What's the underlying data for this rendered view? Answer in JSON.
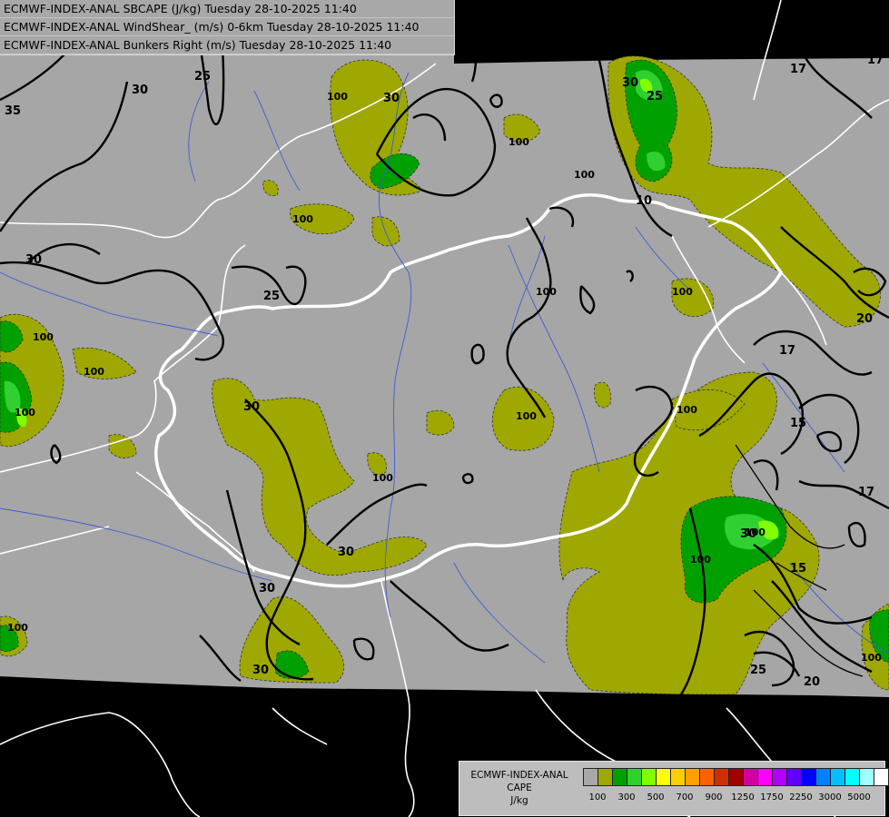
{
  "header": {
    "lines": [
      "ECMWF-INDEX-ANAL SBCAPE (J/kg) Tuesday 28-10-2025 11:40",
      "ECMWF-INDEX-ANAL WindShear_ (m/s) 0-6km Tuesday 28-10-2025 11:40",
      "ECMWF-INDEX-ANAL Bunkers Right (m/s) Tuesday 28-10-2025 11:40"
    ]
  },
  "legend": {
    "title_line1": "ECMWF-INDEX-ANAL",
    "title_line2": "CAPE",
    "unit": "J/kg",
    "colors": [
      "#a8a8a8",
      "#9ea800",
      "#00a000",
      "#30d030",
      "#80ff00",
      "#ffff00",
      "#ffd000",
      "#ffa000",
      "#ff6000",
      "#d03000",
      "#a00000",
      "#d000a0",
      "#ff00ff",
      "#b000ff",
      "#6000ff",
      "#0000ff",
      "#0080ff",
      "#00c0ff",
      "#00ffff",
      "#a0ffff",
      "#ffffff"
    ],
    "tick_labels": [
      "100",
      "300",
      "500",
      "700",
      "900",
      "1250",
      "1750",
      "2250",
      "3000",
      "5000"
    ]
  },
  "contour_labels": {
    "shear": [
      "35",
      "30",
      "25",
      "30",
      "30",
      "25",
      "30",
      "30",
      "30",
      "30",
      "30",
      "30",
      "25",
      "20",
      "17",
      "17",
      "15",
      "15",
      "17",
      "17",
      "25",
      "20",
      "10"
    ],
    "cape": [
      "100",
      "100",
      "100",
      "100",
      "100",
      "100",
      "100",
      "100",
      "100",
      "100",
      "100",
      "100",
      "100",
      "100",
      "100",
      "100"
    ]
  }
}
